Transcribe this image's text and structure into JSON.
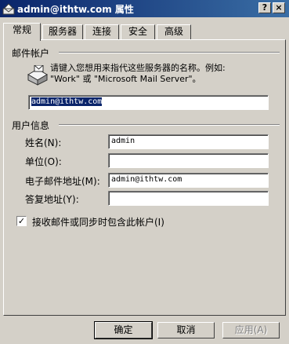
{
  "window": {
    "title": "admin@ithtw.com 属性",
    "help_button": "?",
    "close_button": "×"
  },
  "tabs": [
    {
      "label": "常规"
    },
    {
      "label": "服务器"
    },
    {
      "label": "连接"
    },
    {
      "label": "安全"
    },
    {
      "label": "高级"
    }
  ],
  "general": {
    "account_group": "邮件帐户",
    "hint_line1": "请键入您想用来指代这些服务器的名称。例如:",
    "hint_line2": "\"Work\" 或 \"Microsoft Mail Server\"。",
    "account_name": "admin@ithtw.com",
    "user_group": "用户信息",
    "fields": [
      {
        "label": "姓名(N):",
        "value": "admin"
      },
      {
        "label": "单位(O):",
        "value": ""
      },
      {
        "label": "电子邮件地址(M):",
        "value": "admin@ithtw.com"
      },
      {
        "label": "答复地址(Y):",
        "value": ""
      }
    ],
    "include_checkbox": {
      "label": "接收邮件或同步时包含此帐户(I)",
      "checked": true,
      "mark": "✓"
    }
  },
  "buttons": {
    "ok": "确定",
    "cancel": "取消",
    "apply": "应用(A)"
  },
  "colors": {
    "titlebar_start": "#0a246a",
    "titlebar_end": "#3a6ea5",
    "dialog_bg": "#d4d0c8",
    "selection": "#0a246a"
  }
}
